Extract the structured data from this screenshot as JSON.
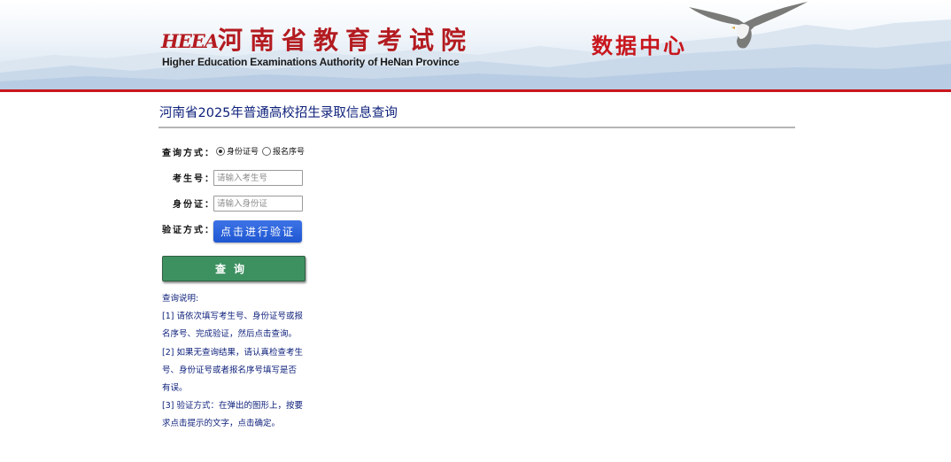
{
  "header": {
    "logo_text": "HEEA",
    "org_name": "河南省教育考试院",
    "org_name_en": "Higher Education Examinations Authority of HeNan Province",
    "section_title": "数据中心"
  },
  "page": {
    "title": "河南省2025年普通高校招生录取信息查询"
  },
  "form": {
    "query_method_label": "查询方式：",
    "options": [
      "身份证号",
      "报名序号"
    ],
    "selected_option": "身份证号",
    "exam_no_label": "考生号：",
    "exam_no_placeholder": "请输入考生号",
    "id_label": "身份证：",
    "id_placeholder": "请输入身份证",
    "verify_label": "验证方式：",
    "verify_button": "点击进行验证",
    "query_button": "查询"
  },
  "notes": [
    "查询说明:",
    "[1] 请依次填写考生号、身份证号或报",
    "名序号、完成验证，然后点击查询。",
    "[2] 如果无查询结果，请认真检查考生",
    "号、身份证号或者报名序号填写是否",
    "有误。",
    "[3] 验证方式：在弹出的图形上，按要",
    "求点击提示的文字，点击确定。"
  ],
  "colors": {
    "brand_red": "#c8161d",
    "title_blue": "#0c1f7a",
    "verify_blue": "#1f57d2",
    "query_green": "#3d9161"
  }
}
